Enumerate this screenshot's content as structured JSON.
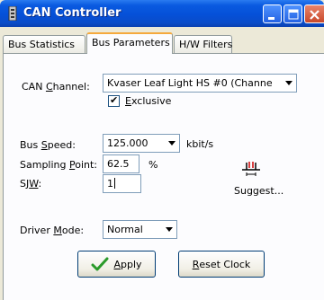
{
  "window": {
    "title": "CAN Controller"
  },
  "tabs": [
    {
      "label": "Bus Statistics"
    },
    {
      "label": "Bus Parameters"
    },
    {
      "label": "H/W Filters"
    }
  ],
  "form": {
    "can_channel": {
      "label_pre": "CAN ",
      "label_ul": "C",
      "label_post": "hannel:",
      "value": "Kvaser Leaf Light HS #0 (Channe"
    },
    "exclusive": {
      "label_ul": "E",
      "label_post": "xclusive",
      "checked": "✔"
    },
    "bus_speed": {
      "label_pre": "Bus ",
      "label_ul": "S",
      "label_post": "peed:",
      "value": "125.000",
      "unit": "kbit/s"
    },
    "sampling_point": {
      "label_pre": "Sampling ",
      "label_ul": "P",
      "label_post": "oint:",
      "value": "62.5",
      "unit": "%"
    },
    "sjw": {
      "label_pre": "SJ",
      "label_ul": "W",
      "label_post": ":",
      "value": "1"
    },
    "suggest": {
      "label": "Suggest..."
    },
    "driver_mode": {
      "label_pre": "Driver ",
      "label_ul": "M",
      "label_post": "ode:",
      "value": "Normal"
    }
  },
  "buttons": {
    "apply": {
      "label_ul": "A",
      "label_post": "pply"
    },
    "reset_clock": {
      "label_ul": "R",
      "label_post": "eset Clock"
    }
  },
  "colors": {
    "titlebar": "#0550d8",
    "active_tab_accent": "#f5a93c",
    "apply_check": "#2a9a2a"
  }
}
